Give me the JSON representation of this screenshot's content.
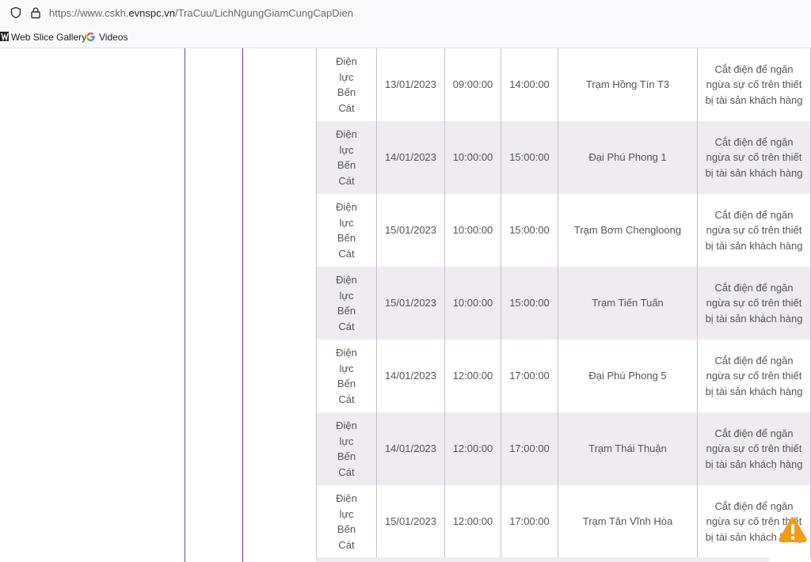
{
  "browser": {
    "url_prefix": "https://www.cskh.",
    "url_domain": "evnspc.vn",
    "url_path": "/TraCuu/LichNgungGiamCungCapDien",
    "bookmarks": [
      "Web Slice Gallery",
      "Videos"
    ]
  },
  "colors": {
    "purple_line": "#7d3c98",
    "row_alt": "#efebf1",
    "warning": "#f39c12"
  },
  "rows": [
    {
      "unit": "Điện lực Bến Cát",
      "date": "13/01/2023",
      "start": "09:00:00",
      "end": "14:00:00",
      "area": "Trạm Hồng Tín T3",
      "reason": "Cắt điện để ngăn ngừa sự cố trên thiết bị tài sản khách hàng"
    },
    {
      "unit": "Điện lực Bến Cát",
      "date": "14/01/2023",
      "start": "10:00:00",
      "end": "15:00:00",
      "area": "Đại Phú Phong 1",
      "reason": "Cắt điện để ngăn ngừa sự cố trên thiết bị tài sản khách hàng"
    },
    {
      "unit": "Điện lực Bến Cát",
      "date": "15/01/2023",
      "start": "10:00:00",
      "end": "15:00:00",
      "area": "Trạm Bơm Chengloong",
      "reason": "Cắt điện để ngăn ngừa sự cố trên thiết bị tài sản khách hàng"
    },
    {
      "unit": "Điện lực Bến Cát",
      "date": "15/01/2023",
      "start": "10:00:00",
      "end": "15:00:00",
      "area": "Trạm Tiến Tuấn",
      "reason": "Cắt điện để ngăn ngừa sự cố trên thiết bị tài sản khách hàng"
    },
    {
      "unit": "Điện lực Bến Cát",
      "date": "14/01/2023",
      "start": "12:00:00",
      "end": "17:00:00",
      "area": "Đại Phú Phong 5",
      "reason": "Cắt điện để ngăn ngừa sự cố trên thiết bị tài sản khách hàng"
    },
    {
      "unit": "Điện lực Bến Cát",
      "date": "14/01/2023",
      "start": "12:00:00",
      "end": "17:00:00",
      "area": "Trạm Thái Thuận",
      "reason": "Cắt điện để ngăn ngừa sự cố trên thiết bị tài sản khách hàng"
    },
    {
      "unit": "Điện lực Bến Cát",
      "date": "15/01/2023",
      "start": "12:00:00",
      "end": "17:00:00",
      "area": "Trạm Tân Vĩnh Hòa",
      "reason": "Cắt điện để ngăn ngừa sự cố trên thiết bị tài sản khách hàng"
    }
  ]
}
